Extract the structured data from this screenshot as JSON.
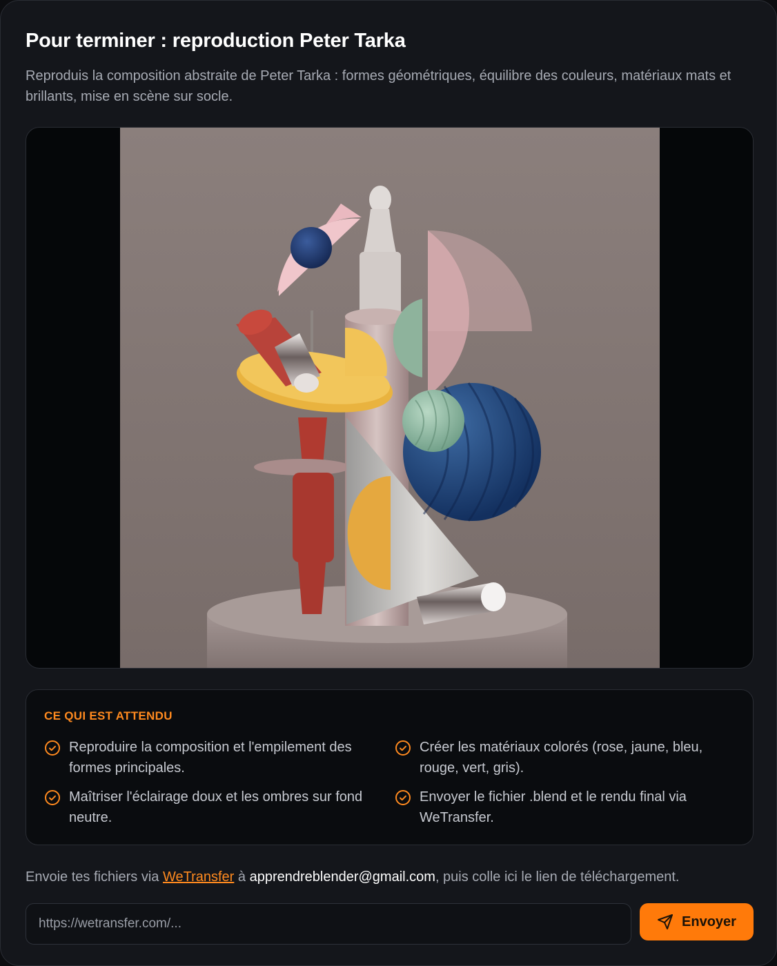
{
  "page": {
    "title": "Pour terminer : reproduction Peter Tarka",
    "description": "Reproduis la composition abstraite de Peter Tarka : formes géométriques, équilibre des couleurs, matériaux mats et brillants, mise en scène sur socle."
  },
  "media": {
    "image_icon": "sculpture-render-image"
  },
  "expectations": {
    "heading": "CE QUI EST ATTENDU",
    "items": [
      {
        "text": "Reproduire la composition et l'empilement des formes principales.",
        "icon": "check-circle-icon"
      },
      {
        "text": "Créer les matériaux colorés (rose, jaune, bleu, rouge, vert, gris).",
        "icon": "check-circle-icon"
      },
      {
        "text": "Maîtriser l'éclairage doux et les ombres sur fond neutre.",
        "icon": "check-circle-icon"
      },
      {
        "text": "Envoyer le fichier .blend et le rendu final via WeTransfer.",
        "icon": "check-circle-icon"
      }
    ]
  },
  "submission": {
    "prefix": "Envoie tes fichiers via ",
    "link_label": "WeTransfer",
    "middle": " à ",
    "email": "apprendreblender@gmail.com",
    "suffix": ", puis colle ici le lien de téléchargement.",
    "input_placeholder": "https://wetransfer.com/...",
    "button_label": "Envoyer",
    "button_icon": "send-icon"
  },
  "colors": {
    "accent": "#ff7a0a",
    "background": "#14161b",
    "panel": "#0a0c0f"
  }
}
